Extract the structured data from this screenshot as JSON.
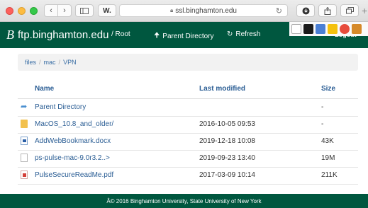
{
  "browser": {
    "url": "ssl.binghamton.edu",
    "w_button": "W.",
    "reload_icon": "reload-icon"
  },
  "navbar": {
    "brand": "ftp.binghamton.edu",
    "root": "/ Root",
    "parent": "Parent Directory",
    "refresh": "Refresh",
    "logout": "Logout"
  },
  "breadcrumb": {
    "items": [
      "files",
      "mac",
      "VPN"
    ],
    "separator": "/"
  },
  "table": {
    "headers": {
      "name": "Name",
      "modified": "Last modified",
      "size": "Size"
    },
    "rows": [
      {
        "icon": "parent-dir-icon",
        "name": "Parent Directory",
        "modified": "",
        "size": "-"
      },
      {
        "icon": "folder-icon",
        "name": "MacOS_10.8_and_older/",
        "modified": "2016-10-05 09:53",
        "size": "-"
      },
      {
        "icon": "word-doc-icon",
        "name": "AddWebBookmark.docx",
        "modified": "2019-12-18 10:08",
        "size": "43K"
      },
      {
        "icon": "file-icon",
        "name": "ps-pulse-mac-9.0r3.2..>",
        "modified": "2019-09-23 13:40",
        "size": "19M"
      },
      {
        "icon": "pdf-icon",
        "name": "PulseSecureReadMe.pdf",
        "modified": "2017-03-09 10:14",
        "size": "211K"
      }
    ]
  },
  "footer": {
    "text": "Â© 2016 Binghamton University, State University of New York"
  },
  "colors": {
    "navbar": "#00573f",
    "link": "#2a5d94"
  }
}
